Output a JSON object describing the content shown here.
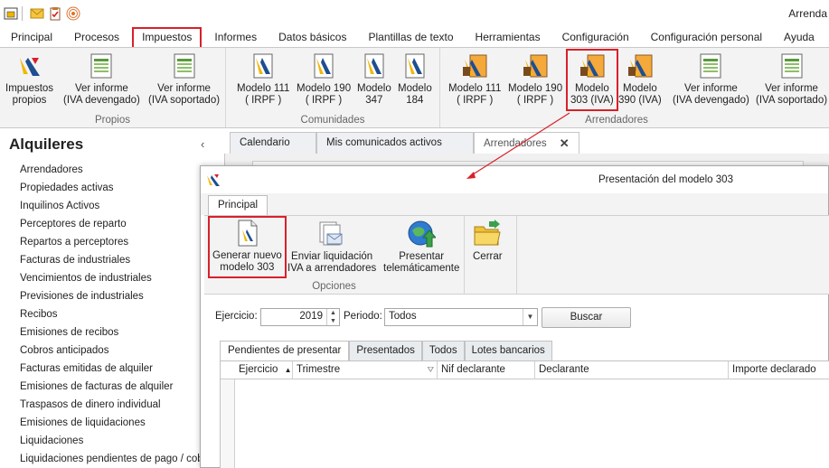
{
  "app": {
    "title": "Arrenda"
  },
  "menu": [
    "Principal",
    "Procesos",
    "Impuestos",
    "Informes",
    "Datos básicos",
    "Plantillas de texto",
    "Herramientas",
    "Configuración",
    "Configuración personal",
    "Ayuda"
  ],
  "ribbon": {
    "propios": {
      "label": "Propios",
      "buttons": [
        {
          "l1": "Impuestos",
          "l2": "propios"
        },
        {
          "l1": "Ver informe",
          "l2": "(IVA devengado)"
        },
        {
          "l1": "Ver informe",
          "l2": "(IVA soportado)"
        }
      ]
    },
    "comunidades": {
      "label": "Comunidades",
      "buttons": [
        {
          "l1": "Modelo 111",
          "l2": "( IRPF )"
        },
        {
          "l1": "Modelo 190",
          "l2": "( IRPF )"
        },
        {
          "l1": "Modelo",
          "l2": "347"
        },
        {
          "l1": "Modelo",
          "l2": "184"
        }
      ]
    },
    "arrendadores": {
      "label": "Arrendadores",
      "buttons": [
        {
          "l1": "Modelo 111",
          "l2": "( IRPF )"
        },
        {
          "l1": "Modelo 190",
          "l2": "( IRPF )"
        },
        {
          "l1": "Modelo",
          "l2": "303 (IVA)"
        },
        {
          "l1": "Modelo",
          "l2": "390 (IVA)"
        },
        {
          "l1": "Ver informe",
          "l2": "(IVA devengado)"
        },
        {
          "l1": "Ver informe",
          "l2": "(IVA soportado)"
        }
      ]
    }
  },
  "sidebar": {
    "title": "Alquileres",
    "items": [
      "Arrendadores",
      "Propiedades activas",
      "Inquilinos Activos",
      "Perceptores de reparto",
      "Repartos a perceptores",
      "Facturas de industriales",
      "Vencimientos de industriales",
      "Previsiones de industriales",
      "Recibos",
      "Emisiones de recibos",
      "Cobros anticipados",
      "Facturas emitidas de alquiler",
      "Emisiones de facturas de alquiler",
      "Traspasos de dinero individual",
      "Emisiones de liquidaciones",
      "Liquidaciones",
      "Liquidaciones pendientes de pago / cobro"
    ]
  },
  "doc_tabs": [
    "Calendario",
    "Mis comunicados activos",
    "Arrendadores"
  ],
  "dialog": {
    "title": "Presentación del modelo 303",
    "tab": "Principal",
    "group_label": "Opciones",
    "buttons": [
      {
        "l1": "Generar nuevo",
        "l2": "modelo 303"
      },
      {
        "l1": "Enviar liquidación",
        "l2": "IVA a arrendadores"
      },
      {
        "l1": "Presentar",
        "l2": "telemáticamente"
      },
      {
        "l1": "Cerrar",
        "l2": ""
      }
    ],
    "filter": {
      "ejercicio_label": "Ejercicio:",
      "ejercicio_value": "2019",
      "periodo_label": "Periodo:",
      "periodo_value": "Todos",
      "search_button": "Buscar"
    },
    "tabs": [
      "Pendientes de presentar",
      "Presentados",
      "Todos",
      "Lotes bancarios"
    ],
    "columns": [
      "Ejercicio",
      "Trimestre",
      "Nif declarante",
      "Declarante",
      "Importe declarado"
    ]
  },
  "colors": {
    "highlight": "#d9202a",
    "ribbon_bg": "#f3f3f3"
  }
}
